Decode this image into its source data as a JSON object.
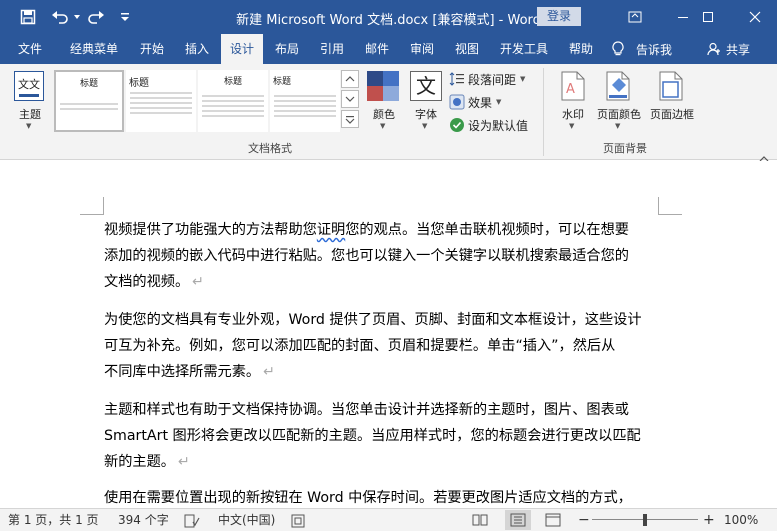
{
  "titlebar": {
    "title": "新建 Microsoft Word 文档.docx [兼容模式]  -  Word",
    "login": "登录",
    "save_icon": "save-icon",
    "undo_icon": "undo-icon",
    "redo_icon": "redo-icon",
    "customize_icon": "customize-qat-icon"
  },
  "tabs": [
    {
      "label": "文件"
    },
    {
      "label": "经典菜单"
    },
    {
      "label": "开始"
    },
    {
      "label": "插入"
    },
    {
      "label": "设计"
    },
    {
      "label": "布局"
    },
    {
      "label": "引用"
    },
    {
      "label": "邮件"
    },
    {
      "label": "审阅"
    },
    {
      "label": "视图"
    },
    {
      "label": "开发工具"
    },
    {
      "label": "帮助"
    }
  ],
  "tellme": "告诉我",
  "share": "共享",
  "ribbon": {
    "theme_label": "主题",
    "gallery": [
      {
        "title": "标题"
      },
      {
        "title": "标题"
      },
      {
        "title": "标题"
      },
      {
        "title": "标题"
      },
      {
        "title": "标题"
      }
    ],
    "colors_label": "颜色",
    "fonts_label": "字体",
    "fonts_glyph": "文",
    "theme_glyph": "文文",
    "paragraph_spacing": "段落间距",
    "effects": "效果",
    "set_default": "设为默认值",
    "watermark_label": "水印",
    "page_color_label": "页面颜色",
    "page_border_label": "页面边框",
    "group_document_format": "文档格式",
    "group_page_background": "页面背景"
  },
  "document": {
    "paragraphs": [
      {
        "lines": [
          "视频提供了功能强大的方法帮助您证明您的观点。当您单击联机视频时，可以在想要",
          "添加的视频的嵌入代码中进行粘贴。您也可以键入一个关键字以联机搜索最适合您的",
          "文档的视频。"
        ]
      },
      {
        "lines": [
          "为使您的文档具有专业外观，Word 提供了页眉、页脚、封面和文本框设计，这些设计",
          "可互为补充。例如，您可以添加匹配的封面、页眉和提要栏。单击“插入”，然后从",
          "不同库中选择所需元素。"
        ]
      },
      {
        "lines": [
          "主题和样式也有助于文档保持协调。当您单击设计并选择新的主题时，图片、图表或",
          "SmartArt 图形将会更改以匹配新的主题。当应用样式时，您的标题会进行更改以匹配",
          "新的主题。"
        ]
      },
      {
        "lines": [
          "使用在需要位置出现的新按钮在 Word 中保存时间。若要更改图片适应文档的方式，"
        ]
      }
    ],
    "para_mark": "↵",
    "squiggle_word": "证明"
  },
  "status": {
    "page": "第 1 页，共 1 页",
    "words": "394 个字",
    "language": "中文(中国)",
    "zoom": "100%",
    "zoom_minus": "−",
    "zoom_plus": "+",
    "zoom_fraction": 0.5
  },
  "colors": {
    "brand": "#2b579a",
    "ribbon_bg": "#f3f3f3"
  }
}
